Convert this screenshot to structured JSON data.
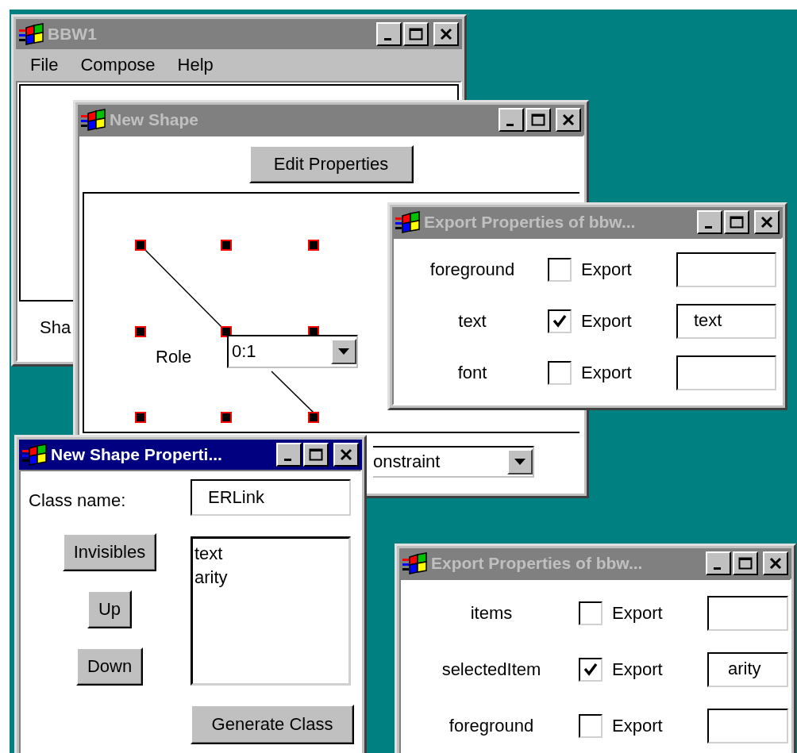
{
  "windows": [
    {
      "kind": "main",
      "title": "BBW1",
      "active": false,
      "menu": [
        "File",
        "Compose",
        "Help"
      ],
      "status_text": "Sha"
    },
    {
      "kind": "shape_editor",
      "title": "New Shape",
      "active": false,
      "button": "Edit Properties",
      "role_label": "Role",
      "role_value": "0:1",
      "constraint_value": "onstraint"
    },
    {
      "kind": "export",
      "title": "Export Properties of bbw...",
      "active": false,
      "rows": [
        {
          "name": "foreground",
          "export_label": "Export",
          "checked": false
        },
        {
          "name": "text",
          "export_label": "Export",
          "checked": true,
          "value": "text"
        },
        {
          "name": "font",
          "export_label": "Export",
          "checked": false
        }
      ]
    },
    {
      "kind": "class_editor",
      "title": "New Shape Properti...",
      "active": true,
      "class_label": "Class name:",
      "class_value": "ERLink",
      "buttons": [
        "Invisibles",
        "Up",
        "Down"
      ],
      "list_items": [
        "text",
        "arity"
      ],
      "generate_button": "Generate Class"
    },
    {
      "kind": "export",
      "title": "Export Properties of bbw...",
      "active": false,
      "rows": [
        {
          "name": "items",
          "export_label": "Export",
          "checked": false
        },
        {
          "name": "selectedItem",
          "export_label": "Export",
          "checked": true,
          "value": "arity"
        },
        {
          "name": "foreground",
          "export_label": "Export",
          "checked": false
        }
      ]
    }
  ]
}
